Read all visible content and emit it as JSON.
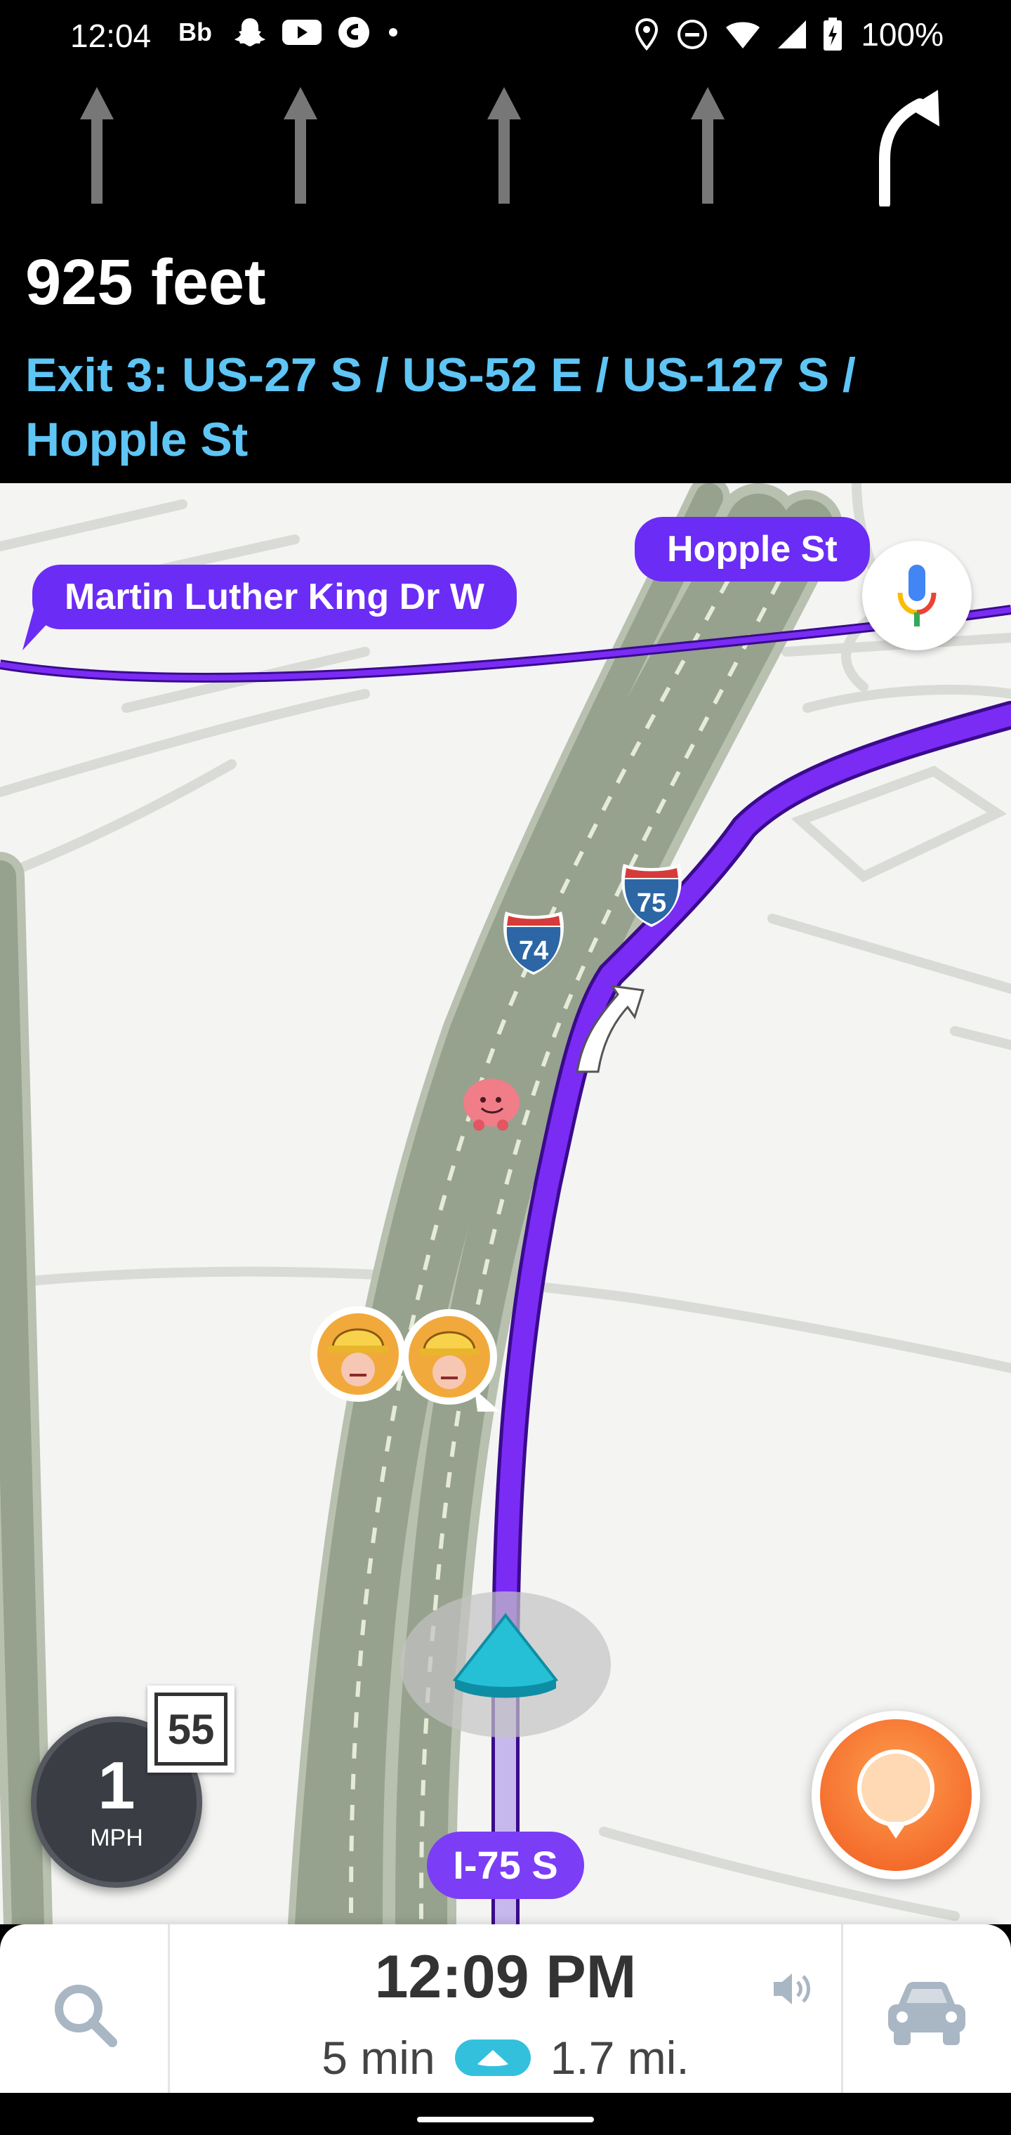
{
  "status_bar": {
    "time": "12:04",
    "battery": "100%",
    "left_icons": [
      "bb-icon",
      "snapchat-icon",
      "youtube-icon",
      "app-icon",
      "dot-icon"
    ],
    "right_icons": [
      "location-icon",
      "dnd-icon",
      "wifi-icon",
      "signal-icon",
      "battery-icon"
    ]
  },
  "nav_banner": {
    "lanes": [
      "straight",
      "straight",
      "straight",
      "straight",
      "slight-right"
    ],
    "distance": "925 feet",
    "exit_text": "Exit 3: US-27 S / US-52 E / US-127 S / Hopple St"
  },
  "map": {
    "street_labels": {
      "mlk": "Martin Luther King Dr W",
      "hopple": "Hopple St"
    },
    "shields": [
      "74",
      "75"
    ],
    "route_color": "#6b1ee8",
    "current_road": "I-75 S"
  },
  "speedometer": {
    "speed": "1",
    "unit": "MPH",
    "limit": "55"
  },
  "bottom_bar": {
    "eta": "12:09 PM",
    "duration": "5 min",
    "distance": "1.7 mi."
  }
}
